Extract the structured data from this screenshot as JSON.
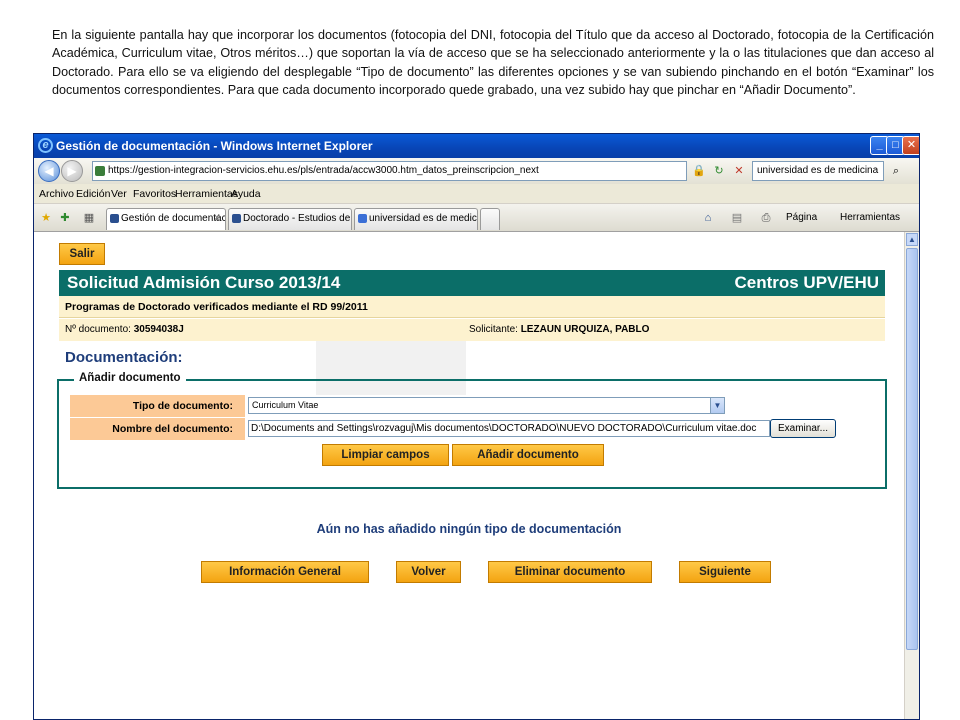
{
  "intro": {
    "text": "En la siguiente pantalla hay que incorporar los documentos (fotocopia del DNI, fotocopia del Título que da acceso al Doctorado, fotocopia de la Certificación Académica, Curriculum vitae, Otros méritos…) que soportan la vía de acceso que se ha seleccionado anteriormente y la o las titulaciones que dan acceso al Doctorado. Para ello se va eligiendo del desplegable “Tipo de documento” las diferentes opciones y se van subiendo pinchando en el botón “Examinar” los documentos correspondientes. Para que cada documento incorporado quede grabado, una vez subido hay que pinchar en “Añadir Documento”."
  },
  "window": {
    "title": "Gestión de documentación - Windows Internet Explorer",
    "minimize": "_",
    "maximize": "□",
    "close": "✕"
  },
  "browser": {
    "back": "◀",
    "forward": "▶",
    "url": "https://gestion-integracion-servicios.ehu.es/pls/entrada/accw3000.htm_datos_preinscripcion_next",
    "search_value": "universidad es de medicina",
    "menu": [
      "Archivo",
      "Edición",
      "Ver",
      "Favoritos",
      "Herramientas",
      "Ayuda"
    ],
    "tabs": [
      {
        "label": "Gestión de documentación",
        "close": "X"
      },
      {
        "label": "Doctorado - Estudios de Post..."
      },
      {
        "label": "universidad es de medicina - ..."
      }
    ],
    "commands": {
      "page": "Página",
      "tools": "Herramientas"
    }
  },
  "page": {
    "salir": "Salir",
    "banner_left": "Solicitud Admisión Curso 2013/14",
    "banner_right": "Centros UPV/EHU",
    "programs": "Programas de Doctorado verificados mediante el RD 99/2011",
    "doc_label": "Nº documento:",
    "doc_value": "30594038J",
    "applicant_label": "Solicitante:",
    "applicant_value": "LEZAUN URQUIZA, PABLO",
    "section_title": "Documentación:",
    "add_doc": {
      "legend": "Añadir documento",
      "type_label": "Tipo de documento:",
      "type_value": "Curriculum Vitae",
      "name_label": "Nombre del documento:",
      "file_value": "D:\\Documents and Settings\\rozvaguj\\Mis documentos\\DOCTORADO\\NUEVO DOCTORADO\\Curriculum vitae.doc",
      "browse": "Examinar...",
      "clear": "Limpiar campos",
      "add": "Añadir documento"
    },
    "empty_message": "Aún no has añadido ningún tipo de documentación",
    "buttons": {
      "info": "Información General",
      "back": "Volver",
      "delete": "Eliminar documento",
      "next": "Siguiente"
    }
  },
  "colors": {
    "banner": "#0b6e68",
    "orange_button": "#f3a311",
    "label_bg": "#fcc996",
    "info_bar": "#fdf2cf",
    "heading_text": "#1e3d7a"
  }
}
